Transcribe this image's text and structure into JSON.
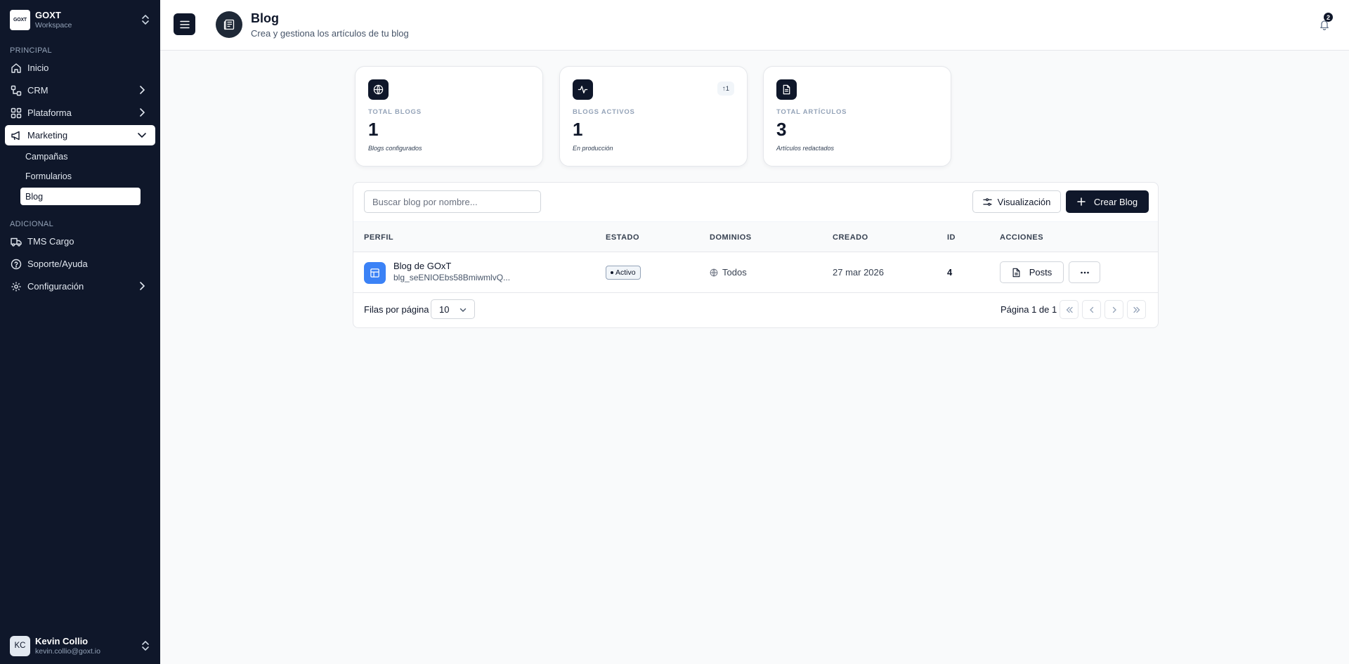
{
  "workspace": {
    "logo": "GOXT",
    "name": "GOXT",
    "sub": "Workspace"
  },
  "sidebar": {
    "section_principal": "PRINCIPAL",
    "section_adicional": "ADICIONAL",
    "items": {
      "inicio": "Inicio",
      "crm": "CRM",
      "plataforma": "Plataforma",
      "marketing": "Marketing",
      "campanas": "Campañas",
      "formularios": "Formularios",
      "blog": "Blog",
      "tms": "TMS Cargo",
      "soporte": "Soporte/Ayuda",
      "config": "Configuración"
    }
  },
  "user": {
    "initials": "KC",
    "name": "Kevin Collio",
    "email": "kevin.collio@goxt.io"
  },
  "header": {
    "title": "Blog",
    "subtitle": "Crea y gestiona los artículos de tu blog",
    "notifications": "2"
  },
  "stats": [
    {
      "label": "TOTAL BLOGS",
      "value": "1",
      "note": "Blogs configurados",
      "icon": "globe-icon"
    },
    {
      "label": "BLOGS ACTIVOS",
      "value": "1",
      "note": "En producción",
      "badge": "↑1",
      "icon": "activity-icon"
    },
    {
      "label": "TOTAL ARTÍCULOS",
      "value": "3",
      "note": "Artículos redactados",
      "icon": "file-text-icon"
    }
  ],
  "table": {
    "search_placeholder": "Buscar blog por nombre...",
    "visualize_label": "Visualización",
    "create_label": "Crear Blog",
    "columns": [
      "PERFIL",
      "ESTADO",
      "DOMINIOS",
      "CREADO",
      "ID",
      "ACCIONES"
    ],
    "rows": [
      {
        "name": "Blog de GOxT",
        "id_text": "blg_seENIOEbs58BmiwmlvQ...",
        "status": "Activo",
        "domains": "Todos",
        "created": "27 mar 2026",
        "id": "4",
        "posts_label": "Posts",
        "more_label": "···"
      }
    ],
    "rows_per_page_label": "Filas por página",
    "rows_per_page": "10",
    "page_label": "Página 1 de 1"
  },
  "colors": {
    "sidebar_bg": "#0f172a",
    "accent": "#0f172a",
    "blog_icon": "#3b82f6"
  }
}
